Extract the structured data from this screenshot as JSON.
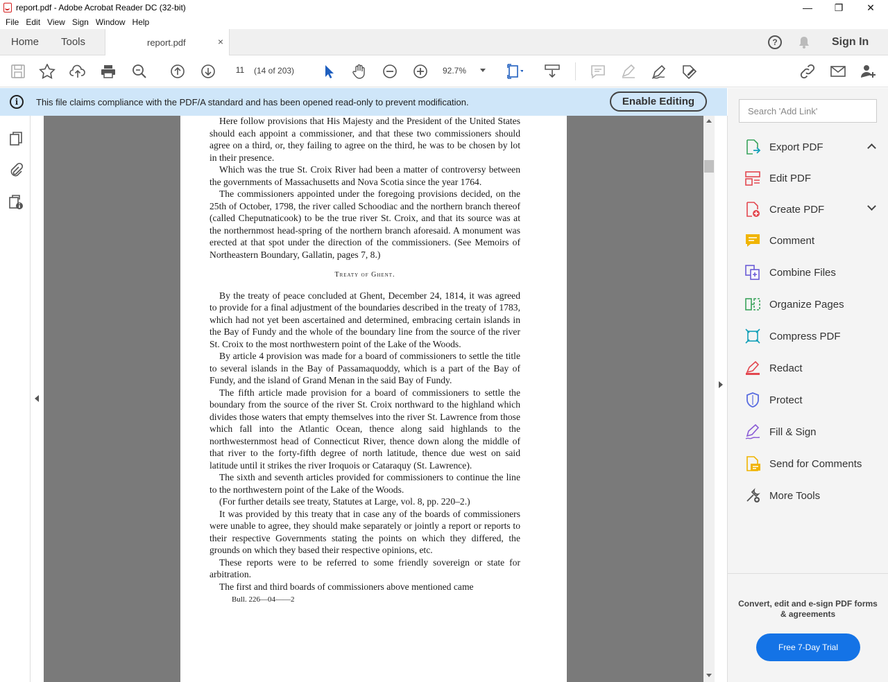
{
  "window": {
    "title": "report.pdf - Adobe Acrobat Reader DC (32-bit)",
    "minimize": "—",
    "maximize": "❐",
    "close": "✕"
  },
  "menu": [
    "File",
    "Edit",
    "View",
    "Sign",
    "Window",
    "Help"
  ],
  "tabs": {
    "home": "Home",
    "tools": "Tools",
    "doc": "report.pdf",
    "doc_close": "×",
    "help": "?",
    "sign_in": "Sign In"
  },
  "toolbar": {
    "page_number": "11",
    "page_of": "(14 of 203)",
    "zoom": "92.7%"
  },
  "banner": {
    "info": "i",
    "message": "This file claims compliance with the PDF/A standard and has been opened read-only to prevent modification.",
    "enable_editing": "Enable Editing"
  },
  "document": {
    "paragraphs_top": [
      "Here follow provisions that His Majesty and the President of the United States should each appoint a commissioner, and that these two commissioners should agree on a third, or, they failing to agree on the third, he was to be chosen by lot in their presence.",
      "Which was the true St. Croix River had been a matter of controversy between the governments of Massachusetts and Nova Scotia since the year 1764.",
      "The commissioners appointed under the foregoing provisions decided, on the 25th of October, 1798, the river called Schoodiac and the northern branch thereof (called Cheputnaticook) to be the true river St. Croix, and that its source was at the northernmost head-spring of the northern branch aforesaid. A monument was erected at that spot under the direction of the commissioners. (See Memoirs of Northeastern Boundary, Gallatin, pages 7, 8.)"
    ],
    "heading": "Treaty of Ghent.",
    "paragraphs_bottom": [
      "By the treaty of peace concluded at Ghent, December 24, 1814, it was agreed to provide for a final adjustment of the boundaries described in the treaty of 1783, which had not yet been ascertained and determined, embracing certain islands in the Bay of Fundy and the whole of the boundary line from the source of the river St. Croix to the most northwestern point of the Lake of the Woods.",
      "By article 4 provision was made for a board of commissioners to settle the title to several islands in the Bay of Passamaquoddy, which is a part of the Bay of Fundy, and the island of Grand Menan in the said Bay of Fundy.",
      "The fifth article made provision for a board of commissioners to settle the boundary from the source of the river St. Croix northward to the highland which divides those waters that empty themselves into the river St. Lawrence from those which fall into the Atlantic Ocean, thence along said highlands to the northwesternmost head of Connecticut River, thence down along the middle of that river to the forty-fifth degree of north latitude, thence due west on said latitude until it strikes the river Iroquois or Cataraquy (St. Lawrence).",
      "The sixth and seventh articles provided for commissioners to continue the line to the northwestern point of the Lake of the Woods.",
      "(For further details see treaty, Statutes at Large, vol. 8, pp. 220–2.)",
      "It was provided by this treaty that in case any of the boards of commissioners were unable to agree, they should make separately or jointly a report or reports to their respective Governments stating the points on which they differed, the grounds on which they based their respective opinions, etc.",
      "These reports were to be referred to some friendly sovereign or state for arbitration.",
      "The first and third boards of commissioners above mentioned came"
    ],
    "footer": "Bull. 226—04——2"
  },
  "right_pane": {
    "search_placeholder": "Search 'Add Link'",
    "tools": [
      {
        "label": "Export PDF",
        "icon": "export-pdf-icon",
        "color": "#3aa35c"
      },
      {
        "label": "Edit PDF",
        "icon": "edit-pdf-icon",
        "color": "#e34850"
      },
      {
        "label": "Create PDF",
        "icon": "create-pdf-icon",
        "color": "#e34850"
      },
      {
        "label": "Comment",
        "icon": "comment-icon",
        "color": "#f0b400"
      },
      {
        "label": "Combine Files",
        "icon": "combine-files-icon",
        "color": "#6b5bd6"
      },
      {
        "label": "Organize Pages",
        "icon": "organize-pages-icon",
        "color": "#3aa35c"
      },
      {
        "label": "Compress PDF",
        "icon": "compress-pdf-icon",
        "color": "#12a0b8"
      },
      {
        "label": "Redact",
        "icon": "redact-icon",
        "color": "#e34850"
      },
      {
        "label": "Protect",
        "icon": "protect-icon",
        "color": "#5a6de0"
      },
      {
        "label": "Fill & Sign",
        "icon": "fill-sign-icon",
        "color": "#8a5bd6"
      },
      {
        "label": "Send for Comments",
        "icon": "send-comments-icon",
        "color": "#f0b400"
      },
      {
        "label": "More Tools",
        "icon": "more-tools-icon",
        "color": "#555555"
      }
    ],
    "promo": "Convert, edit and e-sign PDF forms & agreements",
    "trial_button": "Free 7-Day Trial"
  },
  "colors": {
    "banner_bg": "#cfe6f9",
    "accent_blue": "#1473e6",
    "doc_bg": "#7a7a7a"
  }
}
